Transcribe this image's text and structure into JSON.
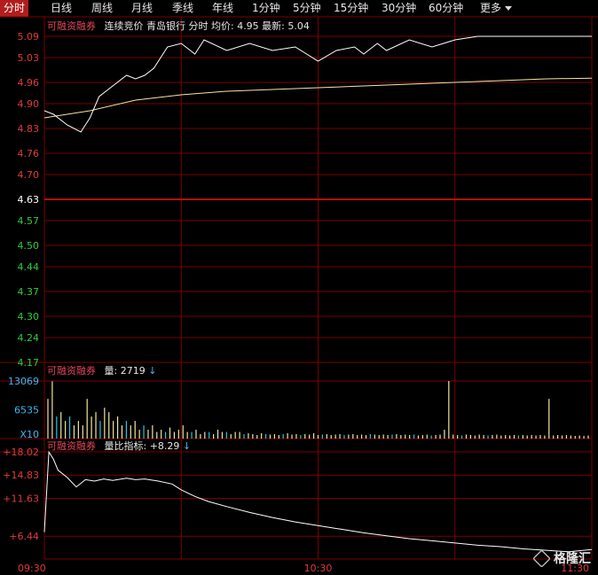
{
  "tabs": [
    {
      "label": "分时",
      "active": true
    },
    {
      "label": "日线"
    },
    {
      "label": "周线"
    },
    {
      "label": "月线"
    },
    {
      "label": "季线"
    },
    {
      "label": "年线"
    },
    {
      "label": "1分钟"
    },
    {
      "label": "5分钟"
    },
    {
      "label": "15分钟"
    },
    {
      "label": "30分钟"
    },
    {
      "label": "60分钟"
    },
    {
      "label": "更多"
    }
  ],
  "price_panel": {
    "tag": "可融资融券",
    "info": "连续竞价 青岛银行 分时 均价: 4.95 最新: 5.04"
  },
  "volume_panel": {
    "tag": "可融资融券",
    "info": "量: 2719"
  },
  "ratio_panel": {
    "tag": "可融资融券",
    "info": "量比指标: +8.29"
  },
  "watermark": "格隆汇",
  "colors": {
    "up": "#e03c3c",
    "down": "#2ecc40",
    "grid": "#7a0000",
    "price_line": "#ffffff",
    "avg_line": "#f5e6a0",
    "volume_up": "#f5e6a0",
    "volume_down": "#21c6e6",
    "marker": "#d64ad6"
  },
  "chart_data": [
    {
      "type": "line",
      "title": "",
      "ylim": [
        4.17,
        5.09
      ],
      "y_ticks": [
        "5.09",
        "5.03",
        "4.96",
        "4.90",
        "4.83",
        "4.76",
        "4.70",
        "4.63",
        "4.57",
        "4.50",
        "4.44",
        "4.37",
        "4.30",
        "4.24",
        "4.17"
      ],
      "prev_close": 4.63,
      "x_labels": [
        "09:30",
        "10:30",
        "11:30"
      ],
      "series": [
        {
          "x": [
            0,
            2,
            5,
            8,
            10,
            12,
            15,
            18,
            20,
            22,
            24,
            27,
            30,
            33,
            35,
            40,
            45,
            50,
            55,
            60,
            64,
            68,
            70,
            73,
            75,
            80,
            85,
            90,
            95,
            100,
            105,
            110,
            115,
            120
          ],
          "values": [
            4.88,
            4.87,
            4.84,
            4.82,
            4.86,
            4.92,
            4.95,
            4.98,
            4.97,
            4.98,
            5.0,
            5.06,
            5.07,
            5.04,
            5.08,
            5.05,
            5.07,
            5.05,
            5.06,
            5.02,
            5.05,
            5.06,
            5.04,
            5.07,
            5.05,
            5.08,
            5.06,
            5.08,
            5.09,
            5.09,
            5.09,
            5.09,
            5.09,
            5.09
          ]
        },
        {
          "x": [
            0,
            10,
            20,
            30,
            40,
            50,
            60,
            70,
            80,
            90,
            100,
            110,
            120
          ],
          "values": [
            4.86,
            4.88,
            4.91,
            4.925,
            4.935,
            4.94,
            4.945,
            4.95,
            4.955,
            4.96,
            4.965,
            4.97,
            4.972
          ]
        }
      ]
    },
    {
      "type": "bar",
      "title": "",
      "ylim": [
        0,
        13069
      ],
      "y_ticks": [
        "13069",
        "6535"
      ],
      "unit": "X10",
      "values": [
        9000,
        13000,
        5000,
        6000,
        4000,
        5000,
        3000,
        4000,
        3000,
        9000,
        5000,
        6000,
        4000,
        7000,
        6000,
        4000,
        5000,
        3000,
        4000,
        3000,
        4000,
        2000,
        3000,
        2000,
        3000,
        1500,
        2000,
        1500,
        2500,
        1500,
        2000,
        3000,
        1500,
        1500,
        2000,
        1000,
        1500,
        1500,
        1000,
        2000,
        1500,
        1500,
        1000,
        1500,
        1500,
        1000,
        1200,
        1000,
        800,
        1200,
        1000,
        900,
        1000,
        800,
        1000,
        1200,
        900,
        1000,
        800,
        1000,
        900,
        1200,
        800,
        900,
        1000,
        800,
        900,
        1000,
        800,
        900,
        1000,
        800,
        900,
        800,
        1000,
        900,
        800,
        900,
        800,
        900,
        1000,
        800,
        900,
        800,
        900,
        700,
        800,
        900,
        700,
        800,
        900,
        2000,
        13069,
        900,
        800,
        700,
        900,
        800,
        700,
        900,
        800,
        700,
        800,
        900,
        700,
        800,
        700,
        800,
        700,
        800,
        700,
        800,
        700,
        800,
        700,
        9000,
        700,
        800,
        700,
        800,
        700,
        600,
        700,
        600,
        700
      ],
      "down_indices": [
        2,
        5,
        12,
        18,
        22,
        27,
        33,
        37,
        41,
        45,
        50,
        54,
        58,
        63,
        68,
        74,
        79,
        84,
        88,
        95,
        101,
        108
      ]
    },
    {
      "type": "line",
      "title": "",
      "ylim": [
        3.3,
        18.02
      ],
      "y_ticks": [
        "+18.02",
        "+14.83",
        "+11.63",
        "+6.44"
      ],
      "series": [
        {
          "x": [
            0,
            1,
            2,
            3,
            5,
            7,
            9,
            11,
            13,
            15,
            18,
            20,
            22,
            25,
            28,
            30,
            33,
            36,
            40,
            45,
            50,
            55,
            60,
            65,
            70,
            75,
            80,
            85,
            90,
            95,
            100,
            105,
            110,
            115,
            120
          ],
          "values": [
            7.0,
            18.0,
            17.0,
            15.5,
            14.5,
            13.2,
            14.2,
            14.0,
            14.3,
            14.1,
            14.4,
            14.2,
            14.3,
            14.0,
            13.6,
            12.8,
            11.9,
            11.2,
            10.5,
            9.7,
            9.0,
            8.4,
            7.9,
            7.4,
            6.9,
            6.5,
            6.1,
            5.8,
            5.5,
            5.2,
            5.0,
            4.7,
            4.5,
            4.3,
            4.6
          ]
        }
      ]
    }
  ]
}
